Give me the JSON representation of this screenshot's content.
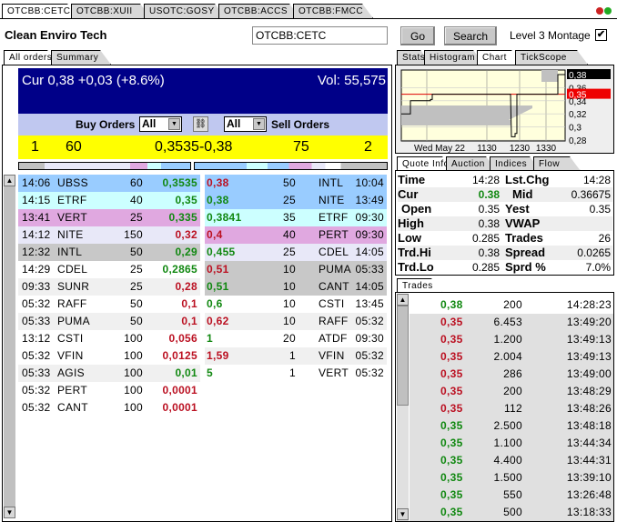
{
  "window_tabs": [
    {
      "label": "OTCBB:CETC",
      "active": true
    },
    {
      "label": "OTCBB:XUII"
    },
    {
      "label": "USOTC:GOSY"
    },
    {
      "label": "OTCBB:ACCS"
    },
    {
      "label": "OTCBB:FMCC"
    }
  ],
  "header": {
    "company": "Clean Enviro Tech",
    "symbol_input": "OTCBB:CETC",
    "go_label": "Go",
    "search_label": "Search",
    "level3_label": "Level 3 Montage",
    "level3_checked": true
  },
  "left_tabs": [
    {
      "label": "All orders",
      "active": true
    },
    {
      "label": "Summary"
    }
  ],
  "summary": {
    "cur": "Cur 0,38 +0,03 (+8.6%)",
    "vol": "Vol: 55,575",
    "buy_label": "Buy Orders",
    "sell_label": "Sell Orders",
    "buy_filter": "All",
    "sell_filter": "All",
    "buy_count": "1",
    "buy_size": "60",
    "spread": "0,3535-0,38",
    "sell_size": "75",
    "sell_count": "2"
  },
  "colors": {
    "blue": "#99ccff",
    "cyan": "#ccffff",
    "pink": "#e0a8e0",
    "lavender": "#e8e8f8",
    "gray": "#c8c8c8",
    "light": "#f0f0f0",
    "white": "#ffffff",
    "green": "#118811",
    "red": "#bb1122",
    "header_bg": "#000088",
    "yellow": "#ffff00"
  },
  "buy_orders": [
    {
      "time": "14:06",
      "mm": "UBSS",
      "size": "60",
      "price": "0,3535",
      "dir": "g",
      "bg": "blue"
    },
    {
      "time": "14:15",
      "mm": "ETRF",
      "size": "40",
      "price": "0,35",
      "dir": "g",
      "bg": "cyan"
    },
    {
      "time": "13:41",
      "mm": "VERT",
      "size": "25",
      "price": "0,335",
      "dir": "g",
      "bg": "pink"
    },
    {
      "time": "14:12",
      "mm": "NITE",
      "size": "150",
      "price": "0,32",
      "dir": "r",
      "bg": "lavender"
    },
    {
      "time": "12:32",
      "mm": "INTL",
      "size": "50",
      "price": "0,29",
      "dir": "g",
      "bg": "gray"
    },
    {
      "time": "14:29",
      "mm": "CDEL",
      "size": "25",
      "price": "0,2865",
      "dir": "g",
      "bg": "white"
    },
    {
      "time": "09:33",
      "mm": "SUNR",
      "size": "25",
      "price": "0,28",
      "dir": "r",
      "bg": "light"
    },
    {
      "time": "05:32",
      "mm": "RAFF",
      "size": "50",
      "price": "0,1",
      "dir": "r",
      "bg": "white"
    },
    {
      "time": "05:33",
      "mm": "PUMA",
      "size": "50",
      "price": "0,1",
      "dir": "r",
      "bg": "light"
    },
    {
      "time": "13:12",
      "mm": "CSTI",
      "size": "100",
      "price": "0,056",
      "dir": "r",
      "bg": "white"
    },
    {
      "time": "05:32",
      "mm": "VFIN",
      "size": "100",
      "price": "0,0125",
      "dir": "r",
      "bg": "white"
    },
    {
      "time": "05:33",
      "mm": "AGIS",
      "size": "100",
      "price": "0,01",
      "dir": "g",
      "bg": "light"
    },
    {
      "time": "05:32",
      "mm": "PERT",
      "size": "100",
      "price": "0,0001",
      "dir": "r",
      "bg": "white"
    },
    {
      "time": "05:32",
      "mm": "CANT",
      "size": "100",
      "price": "0,0001",
      "dir": "r",
      "bg": "white"
    }
  ],
  "sell_orders": [
    {
      "price": "0,38",
      "dir": "r",
      "size": "50",
      "mm": "INTL",
      "time": "10:04",
      "bg": "blue"
    },
    {
      "price": "0,38",
      "dir": "g",
      "size": "25",
      "mm": "NITE",
      "time": "13:49",
      "bg": "blue"
    },
    {
      "price": "0,3841",
      "dir": "g",
      "size": "35",
      "mm": "ETRF",
      "time": "09:30",
      "bg": "cyan"
    },
    {
      "price": "0,4",
      "dir": "r",
      "size": "40",
      "mm": "PERT",
      "time": "09:30",
      "bg": "pink"
    },
    {
      "price": "0,455",
      "dir": "g",
      "size": "25",
      "mm": "CDEL",
      "time": "14:05",
      "bg": "lavender"
    },
    {
      "price": "0,51",
      "dir": "r",
      "size": "10",
      "mm": "PUMA",
      "time": "05:33",
      "bg": "gray"
    },
    {
      "price": "0,51",
      "dir": "g",
      "size": "10",
      "mm": "CANT",
      "time": "14:05",
      "bg": "gray"
    },
    {
      "price": "0,6",
      "dir": "g",
      "size": "10",
      "mm": "CSTI",
      "time": "13:45",
      "bg": "white"
    },
    {
      "price": "0,62",
      "dir": "r",
      "size": "10",
      "mm": "RAFF",
      "time": "05:32",
      "bg": "light"
    },
    {
      "price": "1",
      "dir": "g",
      "size": "20",
      "mm": "ATDF",
      "time": "09:30",
      "bg": "white"
    },
    {
      "price": "1,59",
      "dir": "r",
      "size": "1",
      "mm": "VFIN",
      "time": "05:32",
      "bg": "light"
    },
    {
      "price": "5",
      "dir": "g",
      "size": "1",
      "mm": "VERT",
      "time": "05:32",
      "bg": "white"
    }
  ],
  "right_tabs": [
    {
      "label": "Stats"
    },
    {
      "label": "Histogram"
    },
    {
      "label": "Chart",
      "active": true
    },
    {
      "label": "TickScope"
    }
  ],
  "chart": {
    "y_ticks": [
      "0,38",
      "0,36",
      "0,35",
      "0,34",
      "0,32",
      "0,3",
      "0,28"
    ],
    "x_ticks": [
      "Wed May 22",
      "1130",
      "1230",
      "1330"
    ],
    "last_price": "0,38",
    "prev_close": "0,35"
  },
  "quote_tabs": [
    {
      "label": "Quote Info",
      "active": true
    },
    {
      "label": "Auction"
    },
    {
      "label": "Indices"
    },
    {
      "label": "Flow"
    }
  ],
  "quote": [
    {
      "l": "Time",
      "lv": "14:28",
      "r": "Lst.Chg",
      "rv": "14:28"
    },
    {
      "l": "Cur",
      "lv": "0.38",
      "r": "Mid",
      "rv": "0.36675"
    },
    {
      "l": "Open",
      "lv": "0.35",
      "r": "Yest",
      "rv": "0.35"
    },
    {
      "l": "High",
      "lv": "0.38",
      "r": "VWAP",
      "rv": ""
    },
    {
      "l": "Low",
      "lv": "0.285",
      "r": "Trades",
      "rv": "26"
    },
    {
      "l": "Trd.Hi",
      "lv": "0.38",
      "r": "Spread",
      "rv": "0.0265"
    },
    {
      "l": "Trd.Lo",
      "lv": "0.285",
      "r": "Sprd %",
      "rv": "7.0%"
    }
  ],
  "trades_tab": "Trades",
  "trades": [
    {
      "price": "0,38",
      "dir": "g",
      "size": "200",
      "time": "14:28:23"
    },
    {
      "price": "0,35",
      "dir": "r",
      "size": "6.453",
      "time": "13:49:20"
    },
    {
      "price": "0,35",
      "dir": "r",
      "size": "1.200",
      "time": "13:49:13"
    },
    {
      "price": "0,35",
      "dir": "r",
      "size": "2.004",
      "time": "13:49:13"
    },
    {
      "price": "0,35",
      "dir": "r",
      "size": "286",
      "time": "13:49:00"
    },
    {
      "price": "0,35",
      "dir": "r",
      "size": "200",
      "time": "13:48:29"
    },
    {
      "price": "0,35",
      "dir": "r",
      "size": "112",
      "time": "13:48:26"
    },
    {
      "price": "0,35",
      "dir": "g",
      "size": "2.500",
      "time": "13:48:18"
    },
    {
      "price": "0,35",
      "dir": "g",
      "size": "1.100",
      "time": "13:44:34"
    },
    {
      "price": "0,35",
      "dir": "g",
      "size": "4.400",
      "time": "13:44:31"
    },
    {
      "price": "0,35",
      "dir": "g",
      "size": "1.500",
      "time": "13:39:10"
    },
    {
      "price": "0,35",
      "dir": "g",
      "size": "550",
      "time": "13:26:48"
    },
    {
      "price": "0,35",
      "dir": "g",
      "size": "500",
      "time": "13:18:33"
    }
  ]
}
